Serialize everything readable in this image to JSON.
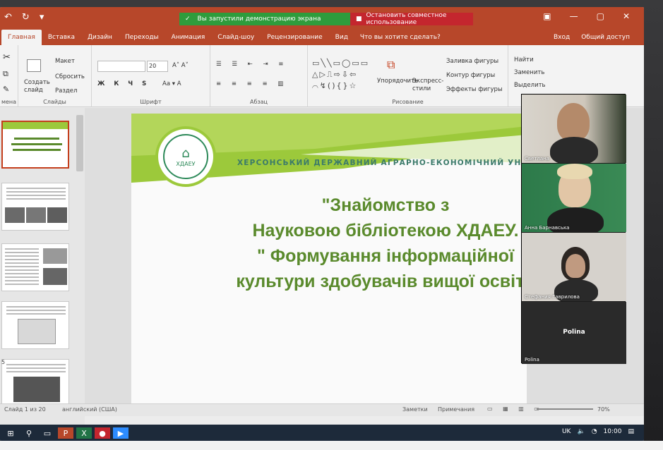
{
  "titlebar": {
    "share_started": "Вы запустили демонстрацию экрана",
    "share_stop": "Остановить совместное использование"
  },
  "tabs": [
    {
      "label": "Главная",
      "active": true
    },
    {
      "label": "Вставка"
    },
    {
      "label": "Дизайн"
    },
    {
      "label": "Переходы"
    },
    {
      "label": "Анимация"
    },
    {
      "label": "Слайд-шоу"
    },
    {
      "label": "Рецензирование"
    },
    {
      "label": "Вид"
    }
  ],
  "tell_me": "Что вы хотите сделать?",
  "tabs_right": {
    "signin": "Вход",
    "share": "Общий доступ"
  },
  "ribbon": {
    "slides": {
      "layout": "Макет",
      "reset": "Сбросить",
      "section": "Раздел",
      "new_slide": "Создать слайд",
      "group": "Слайды"
    },
    "font": {
      "size": "20",
      "group": "Шрифт"
    },
    "paragraph": {
      "group": "Абзац"
    },
    "drawing": {
      "arrange": "Упорядочить",
      "quick_styles": "Экспресс-стили",
      "fill": "Заливка фигуры",
      "outline": "Контур фигуры",
      "effects": "Эффекты фигуры",
      "group": "Рисование"
    },
    "editing": {
      "find": "Найти",
      "replace": "Заменить",
      "select": "Выделить",
      "group": "Ред"
    },
    "clipboard_group": "мена"
  },
  "thumbnails": [
    "",
    "",
    "",
    "",
    "5"
  ],
  "slide": {
    "university": "ХЕРСОНСЬКИЙ ДЕРЖАВНИЙ АГРАРНО-ЕКОНОМІЧНИЙ УНІВЕРСИТЕТ",
    "logo_text": "ХДАЕУ",
    "title_lines": [
      "\"Знайомство з",
      "Науковою бібліотекою ХДАЕУ.",
      "\" Формування інформаційної",
      "культури здобувачів вищої освіти"
    ]
  },
  "participants": [
    {
      "name": "Светлана"
    },
    {
      "name": "Анна Барнавська"
    },
    {
      "name": "Стефания Гаврилова"
    },
    {
      "name": "Polina",
      "center_label": "Polina"
    }
  ],
  "statusbar": {
    "slide_info": "Слайд 1 из 20",
    "language": "английский (США)",
    "notes": "Заметки",
    "comments": "Примечания",
    "zoom": "70%"
  },
  "tray": {
    "lang": "UK",
    "time": "10:00"
  },
  "colors": {
    "ppt_red": "#b7472a",
    "green_banner": "#2e9c3c",
    "red_banner": "#c4262e",
    "slide_green": "#9cc93b",
    "title_green": "#5a8a2c"
  }
}
